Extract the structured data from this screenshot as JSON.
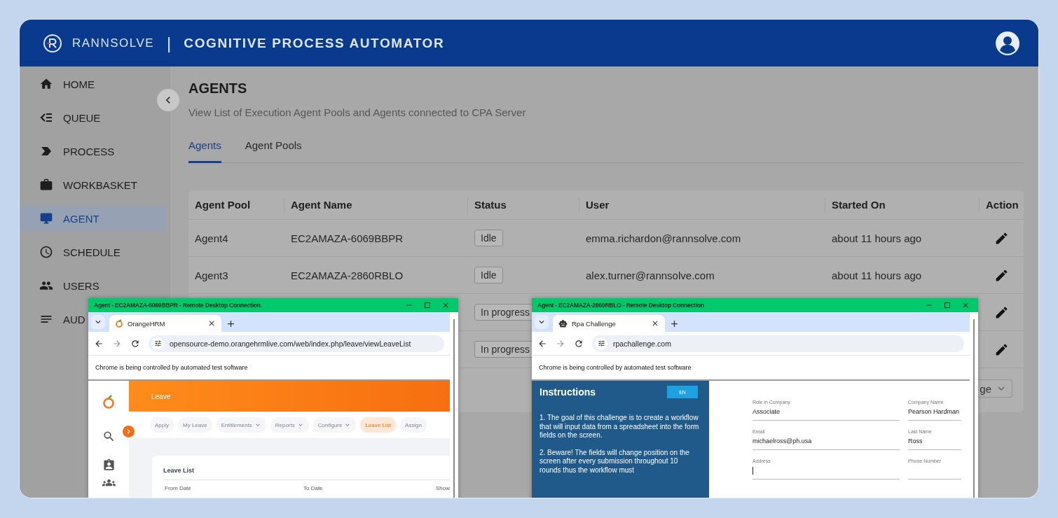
{
  "header": {
    "brand": "RANNSOLVE",
    "separator": "|",
    "title": "COGNITIVE PROCESS AUTOMATOR"
  },
  "sidebar": {
    "items": [
      {
        "label": "HOME",
        "selected": false
      },
      {
        "label": "QUEUE",
        "selected": false
      },
      {
        "label": "PROCESS",
        "selected": false
      },
      {
        "label": "WORKBASKET",
        "selected": false
      },
      {
        "label": "AGENT",
        "selected": true
      },
      {
        "label": "SCHEDULE",
        "selected": false
      },
      {
        "label": "USERS",
        "selected": false
      },
      {
        "label": "AUD",
        "selected": false
      }
    ]
  },
  "page": {
    "title": "AGENTS",
    "subtitle": "View List of Execution Agent Pools and Agents connected to CPA Server"
  },
  "tabs": [
    {
      "label": "Agents",
      "selected": true
    },
    {
      "label": "Agent Pools",
      "selected": false
    }
  ],
  "table": {
    "columns": [
      "Agent Pool",
      "Agent Name",
      "Status",
      "User",
      "Started On",
      "Action"
    ],
    "rows": [
      {
        "agent_pool": "Agent4",
        "agent_name": "EC2AMAZA-6069BBPR",
        "status": "Idle",
        "user": "emma.richardon@rannsolve.com",
        "started_on": "about 11 hours ago"
      },
      {
        "agent_pool": "Agent3",
        "agent_name": "EC2AMAZA-2860RBLO",
        "status": "Idle",
        "user": "alex.turner@rannsolve.com",
        "started_on": "about 11 hours ago"
      },
      {
        "status": "In progress"
      },
      {
        "status": "In progress"
      }
    ],
    "pager": {
      "text": "ge"
    }
  },
  "windows": [
    {
      "kind": "orangehrm",
      "title": "Agent - EC2AMAZA-6069BBPR - Remote Desktop Connection",
      "tab": "OrangeHRM",
      "url": "opensource-demo.orangehrmlive.com/web/index.php/leave/viewLeaveList",
      "infobar": "Chrome is being controlled by automated test software",
      "header": "Leave",
      "nav": [
        {
          "label": "Apply",
          "dropdown": false,
          "selected": false
        },
        {
          "label": "My Leave",
          "dropdown": false,
          "selected": false
        },
        {
          "label": "Entitlements",
          "dropdown": true,
          "selected": false
        },
        {
          "label": "Reports",
          "dropdown": true,
          "selected": false
        },
        {
          "label": "Configure",
          "dropdown": true,
          "selected": false
        },
        {
          "label": "Leave List",
          "dropdown": false,
          "selected": true
        },
        {
          "label": "Assign",
          "dropdown": false,
          "selected": false
        }
      ],
      "card_title": "Leave List",
      "card_columns": [
        "From Date",
        "To Date",
        "Show"
      ]
    },
    {
      "kind": "rpa",
      "title": "Agent - EC2AMAZA-2860RBLO - Remote Desktop Connection",
      "tab": "Rpa Challenge",
      "url": "rpachallenge.com",
      "infobar": "Chrome is being controlled by automated test software",
      "panel_title": "Instructions",
      "language": "EN",
      "paragraphs": [
        "1. The goal of this challenge is to create a workflow that will input data from a spreadsheet into the form fields on the screen.",
        "2. Beware! The fields will change position on the screen after every submission throughout 10 rounds thus the workflow must"
      ],
      "fields": [
        {
          "label": "Role in Company",
          "value": "Associate"
        },
        {
          "label": "Company Name",
          "value": "Pearson Hardman"
        },
        {
          "label": "Email",
          "value": "michaelross@ph.usa"
        },
        {
          "label": "Last Name",
          "value": "Ross"
        },
        {
          "label": "Address"
        },
        {
          "label": "Phone Number"
        }
      ]
    }
  ]
}
